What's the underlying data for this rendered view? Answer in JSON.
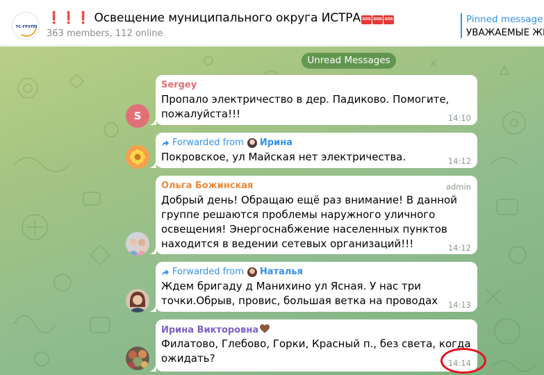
{
  "header": {
    "title_prefix": "❗❗❗",
    "title": "Освещение муниципального округа ИСТРА",
    "sos_label": "SOS",
    "subtitle": "363 members, 112 online",
    "logo_text": "ТС-ГРУПП",
    "pinned_title": "Pinned message",
    "pinned_text": "УВАЖАЕМЫЕ ЖИ"
  },
  "chat": {
    "unread_label": "Unread Messages",
    "messages": [
      {
        "sender": "Sergey",
        "sender_color": "#e17076",
        "avatar_letter": "S",
        "lines": [
          "Пропало электричество в дер. Падиково. Помогите,",
          "пожалуйста!!!"
        ],
        "time": "14:10"
      },
      {
        "forwarded_label": "Forwarded from",
        "forwarded_name": "Ирина",
        "lines": [
          "Покровское, ул Майская нет электричества."
        ],
        "time": "14:12"
      },
      {
        "sender": "Ольга Божинская",
        "sender_color": "#eb8a3a",
        "badge": "admin",
        "lines": [
          "Добрый день! Обращаю ещё раз внимание! В данной",
          "группе решаются проблемы  наружного уличного",
          "освещения! Энергоснабжение населенных пунктов",
          "находится в ведении сетевых организаций!!!"
        ],
        "time": "14:12"
      },
      {
        "forwarded_label": "Forwarded from",
        "forwarded_name": "Наталья",
        "lines": [
          "Ждем бригаду д Манихино ул Ясная. У нас три",
          "точки.Обрыв, провис, большая ветка на проводах"
        ],
        "time": "14:13"
      },
      {
        "sender": "Ирина Викторовна",
        "sender_color": "#7b60c4",
        "lines": [
          "Филатово, Глебово, Горки, Красный п., без света, когда",
          "ожидать?"
        ],
        "time": "14:14"
      }
    ]
  },
  "colors": {
    "accent": "#3390ec",
    "highlight_circle": "#e3101e"
  }
}
